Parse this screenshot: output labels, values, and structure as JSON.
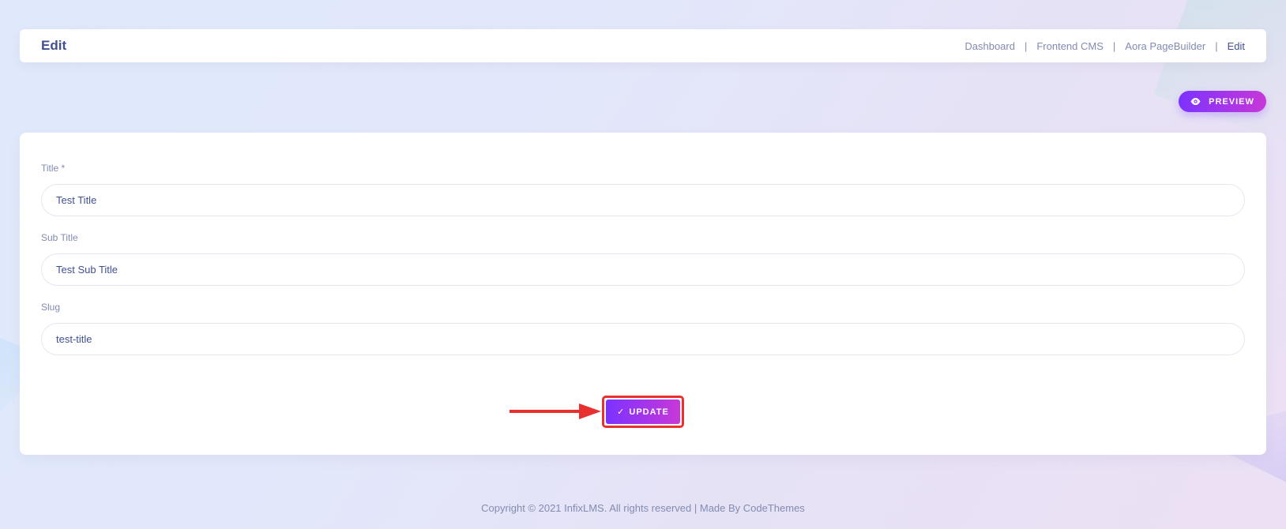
{
  "header": {
    "title": "Edit",
    "breadcrumb": [
      {
        "label": "Dashboard",
        "separator": "|"
      },
      {
        "label": "Frontend CMS",
        "separator": "|"
      },
      {
        "label": "Aora PageBuilder",
        "separator": "|"
      },
      {
        "label": "Edit"
      }
    ]
  },
  "preview_button": {
    "label": "PREVIEW",
    "icon": "eye-icon"
  },
  "form": {
    "title_label": "Title *",
    "title_value": "Test Title",
    "subtitle_label": "Sub Title",
    "subtitle_value": "Test Sub Title",
    "slug_label": "Slug",
    "slug_value": "test-title"
  },
  "update_button": {
    "check": "✓",
    "label": "UPDATE",
    "icon": "check-icon",
    "highlight_color": "#e8302f"
  },
  "annotation": {
    "icon": "arrow-right-icon",
    "color": "#e8302f"
  },
  "footer": {
    "text": "Copyright © 2021 InfixLMS. All rights reserved | Made By CodeThemes"
  },
  "colors": {
    "accent_start": "#7c32ff",
    "accent_end": "#c738d8",
    "text_primary": "#415094",
    "text_muted": "#828bb2"
  }
}
